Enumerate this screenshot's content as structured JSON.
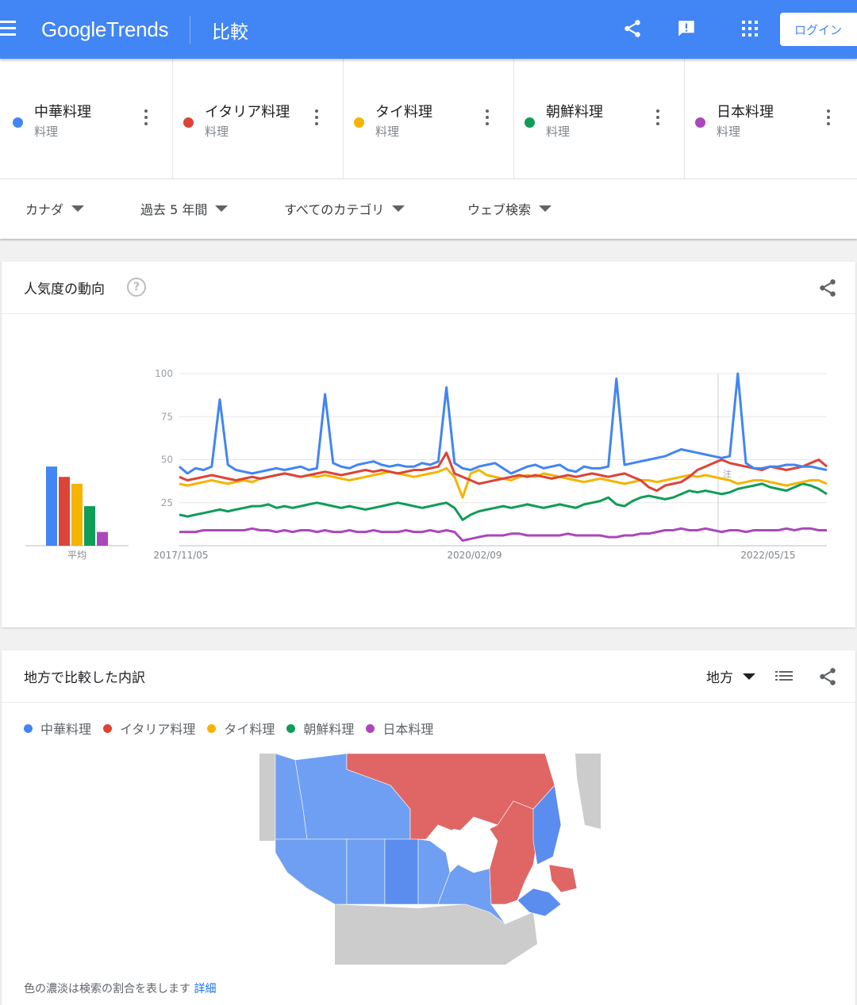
{
  "header": {
    "logo_google": "Google",
    "logo_trends": "Trends",
    "page_title": "比較",
    "login_label": "ログイン",
    "brand_color": "#4285f4"
  },
  "terms": [
    {
      "name": "中華料理",
      "category": "料理",
      "color": "#4285f4"
    },
    {
      "name": "イタリア料理",
      "category": "料理",
      "color": "#db4437"
    },
    {
      "name": "タイ料理",
      "category": "料理",
      "color": "#f4b400"
    },
    {
      "name": "朝鮮料理",
      "category": "料理",
      "color": "#0f9d58"
    },
    {
      "name": "日本料理",
      "category": "料理",
      "color": "#ab47bc"
    }
  ],
  "filters": {
    "region": "カナダ",
    "period": "過去 5 年間",
    "category": "すべてのカテゴリ",
    "search_type": "ウェブ検索"
  },
  "interest_card": {
    "title": "人気度の動向",
    "help_icon": "?",
    "average_label": "平均",
    "note_marker": "注"
  },
  "region_card": {
    "title": "地方で比較した内訳",
    "region_select": "地方",
    "legend": [
      "中華料理",
      "イタリア料理",
      "タイ料理",
      "朝鮮料理",
      "日本料理"
    ],
    "note_text": "色の濃淡は検索の割合を表します",
    "note_link": "詳細",
    "map_regions": {
      "blue": "#6f9ff2",
      "blue_dark": "#5b8def",
      "red": "#e06666",
      "gray": "#cccccc"
    }
  },
  "chart_data": {
    "type": "line",
    "ylim": [
      0,
      100
    ],
    "yticks": [
      25,
      50,
      75,
      100
    ],
    "x_tick_labels": [
      "2017/11/05",
      "2020/02/09",
      "2022/05/15"
    ],
    "x_start": "2017/11/05",
    "x_end": "2022/10/30",
    "averages": [
      {
        "name": "中華料理",
        "value": 46
      },
      {
        "name": "イタリア料理",
        "value": 40
      },
      {
        "name": "タイ料理",
        "value": 36
      },
      {
        "name": "朝鮮料理",
        "value": 23
      },
      {
        "name": "日本料理",
        "value": 8
      }
    ],
    "series": [
      {
        "name": "中華料理",
        "color": "#4285f4",
        "values": [
          46,
          42,
          45,
          44,
          46,
          85,
          47,
          44,
          43,
          42,
          43,
          44,
          45,
          44,
          45,
          46,
          44,
          45,
          88,
          48,
          46,
          45,
          47,
          48,
          49,
          47,
          46,
          47,
          46,
          46,
          48,
          47,
          49,
          92,
          48,
          45,
          44,
          46,
          47,
          48,
          45,
          42,
          44,
          46,
          47,
          45,
          46,
          47,
          44,
          43,
          46,
          45,
          45,
          46,
          97,
          47,
          48,
          49,
          50,
          51,
          52,
          54,
          56,
          55,
          54,
          53,
          52,
          51,
          52,
          100,
          48,
          45,
          45,
          46,
          46,
          47,
          47,
          46,
          46,
          45,
          44
        ]
      },
      {
        "name": "イタリア料理",
        "color": "#db4437",
        "values": [
          40,
          38,
          39,
          40,
          41,
          40,
          39,
          38,
          39,
          40,
          39,
          40,
          41,
          42,
          41,
          40,
          41,
          42,
          43,
          42,
          41,
          42,
          43,
          44,
          43,
          44,
          43,
          42,
          43,
          44,
          44,
          45,
          46,
          54,
          42,
          40,
          38,
          36,
          37,
          38,
          39,
          40,
          41,
          40,
          41,
          40,
          39,
          40,
          41,
          40,
          41,
          42,
          41,
          40,
          41,
          42,
          40,
          38,
          34,
          32,
          35,
          36,
          37,
          40,
          44,
          46,
          48,
          50,
          48,
          47,
          46,
          45,
          44,
          46,
          45,
          44,
          45,
          46,
          48,
          50,
          46
        ]
      },
      {
        "name": "タイ料理",
        "color": "#f4b400",
        "values": [
          36,
          35,
          36,
          37,
          38,
          37,
          36,
          37,
          38,
          37,
          39,
          40,
          41,
          42,
          41,
          40,
          41,
          40,
          41,
          40,
          39,
          38,
          39,
          40,
          41,
          42,
          43,
          42,
          41,
          40,
          41,
          42,
          43,
          45,
          40,
          28,
          42,
          44,
          41,
          40,
          39,
          38,
          40,
          41,
          40,
          42,
          41,
          40,
          39,
          38,
          37,
          38,
          39,
          38,
          37,
          36,
          37,
          38,
          38,
          37,
          38,
          39,
          40,
          41,
          40,
          41,
          40,
          39,
          38,
          36,
          37,
          38,
          38,
          37,
          36,
          35,
          36,
          37,
          38,
          38,
          36
        ]
      },
      {
        "name": "朝鮮料理",
        "color": "#0f9d58",
        "values": [
          18,
          17,
          18,
          19,
          20,
          21,
          20,
          21,
          22,
          23,
          23,
          24,
          22,
          23,
          22,
          23,
          24,
          25,
          24,
          23,
          22,
          23,
          22,
          21,
          22,
          23,
          24,
          25,
          24,
          23,
          22,
          23,
          24,
          25,
          22,
          15,
          18,
          20,
          21,
          22,
          23,
          22,
          23,
          24,
          23,
          22,
          23,
          24,
          23,
          22,
          24,
          25,
          26,
          28,
          24,
          23,
          26,
          28,
          29,
          28,
          27,
          28,
          30,
          32,
          31,
          32,
          31,
          30,
          31,
          33,
          34,
          35,
          36,
          34,
          33,
          32,
          34,
          36,
          35,
          33,
          30
        ]
      },
      {
        "name": "日本料理",
        "color": "#ab47bc",
        "values": [
          8,
          8,
          8,
          9,
          9,
          9,
          9,
          9,
          9,
          10,
          9,
          9,
          8,
          9,
          8,
          9,
          9,
          8,
          9,
          8,
          8,
          9,
          8,
          8,
          9,
          8,
          8,
          8,
          9,
          8,
          8,
          9,
          8,
          9,
          8,
          3,
          4,
          5,
          6,
          6,
          6,
          7,
          7,
          6,
          6,
          6,
          6,
          6,
          7,
          6,
          6,
          6,
          6,
          5,
          5,
          6,
          6,
          7,
          7,
          8,
          9,
          9,
          10,
          9,
          9,
          10,
          9,
          8,
          9,
          9,
          8,
          9,
          9,
          9,
          9,
          10,
          9,
          10,
          10,
          9,
          9
        ]
      }
    ]
  }
}
